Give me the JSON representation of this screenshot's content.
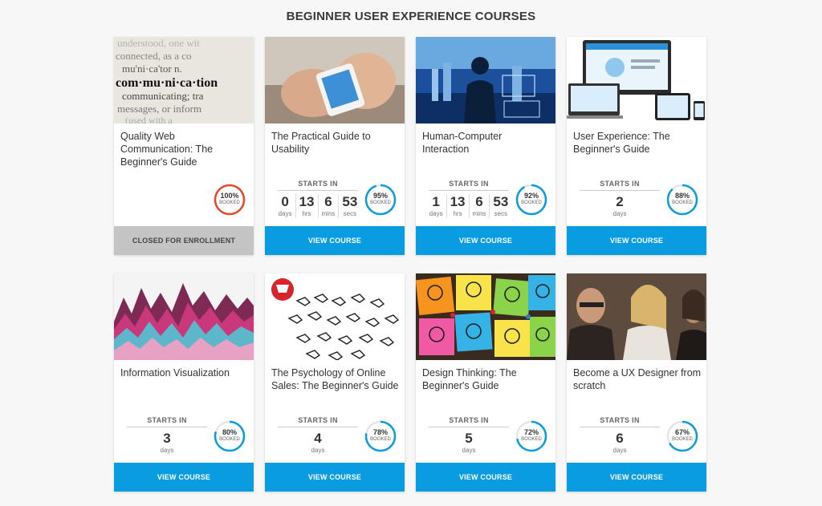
{
  "page_title": "BEGINNER USER EXPERIENCE COURSES",
  "colors": {
    "accent": "#0a9ce0",
    "full": "#e24a2a",
    "closed": "#c4c4c4"
  },
  "labels": {
    "starts_in": "STARTS IN",
    "booked": "BOOKED"
  },
  "courses": [
    {
      "title": "Quality Web Communication: The Beginner's Guide",
      "image": "dictionary-communication-photo",
      "countdown": null,
      "booked_pct": 100,
      "booked_label": "100%",
      "button": "CLOSED FOR ENROLLMENT",
      "closed": true
    },
    {
      "title": "The Practical Guide to Usability",
      "image": "smartphone-hands-photo",
      "countdown": {
        "days": "0",
        "hrs": "13",
        "mins": "6",
        "secs": "53"
      },
      "booked_pct": 95,
      "booked_label": "95%",
      "button": "VIEW COURSE",
      "closed": false
    },
    {
      "title": "Human-Computer Interaction",
      "image": "man-touchscreen-photo",
      "countdown": {
        "days": "1",
        "hrs": "13",
        "mins": "6",
        "secs": "53"
      },
      "booked_pct": 92,
      "booked_label": "92%",
      "button": "VIEW COURSE",
      "closed": false
    },
    {
      "title": "User Experience: The Beginner's Guide",
      "image": "responsive-devices-photo",
      "countdown": {
        "days": "2"
      },
      "booked_pct": 88,
      "booked_label": "88%",
      "button": "VIEW COURSE",
      "closed": false
    },
    {
      "title": "Information Visualization",
      "image": "stream-graph-photo",
      "countdown": {
        "days": "3"
      },
      "booked_pct": 80,
      "booked_label": "80%",
      "button": "VIEW COURSE",
      "closed": false
    },
    {
      "title": "The Psychology of Online Sales: The Beginner's Guide",
      "image": "cursor-hands-cart-photo",
      "countdown": {
        "days": "4"
      },
      "booked_pct": 78,
      "booked_label": "78%",
      "button": "VIEW COURSE",
      "closed": false
    },
    {
      "title": "Design Thinking: The Beginner's Guide",
      "image": "lightbulb-sticky-notes-photo",
      "countdown": {
        "days": "5"
      },
      "booked_pct": 72,
      "booked_label": "72%",
      "button": "VIEW COURSE",
      "closed": false
    },
    {
      "title": "Become a UX Designer from scratch",
      "image": "people-in-audience-photo",
      "countdown": {
        "days": "6"
      },
      "booked_pct": 67,
      "booked_label": "67%",
      "button": "VIEW COURSE",
      "closed": false
    }
  ],
  "unit_labels": {
    "days": "days",
    "hrs": "hrs",
    "mins": "mins",
    "secs": "secs"
  }
}
